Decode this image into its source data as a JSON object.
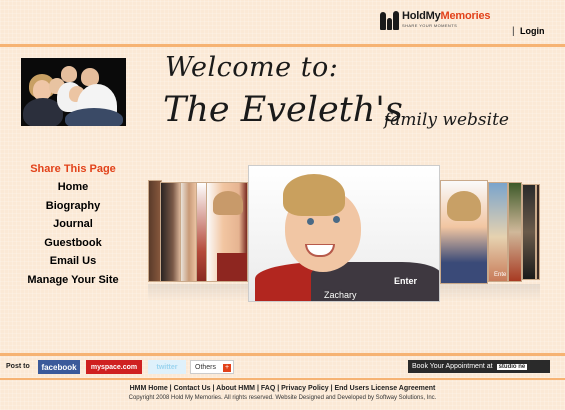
{
  "header": {
    "brand_part1": "Hold",
    "brand_part2": "My",
    "brand_part3": "Memories",
    "tagline": "SHARE YOUR MOMENTS",
    "separator": "|",
    "login_label": "Login"
  },
  "welcome": {
    "line1": "Welcome to:",
    "site_name": "The Eveleth's",
    "subtitle": "family website"
  },
  "nav": {
    "items": [
      {
        "label": "Share This Page"
      },
      {
        "label": "Home"
      },
      {
        "label": "Biography"
      },
      {
        "label": "Journal"
      },
      {
        "label": "Guestbook"
      },
      {
        "label": "Email Us"
      },
      {
        "label": "Manage Your Site"
      }
    ]
  },
  "gallery": {
    "caption": "Zachary",
    "enter_label": "Enter",
    "small_label": "Ente"
  },
  "footer": {
    "post_to": "Post to",
    "facebook": "facebook",
    "myspace": "myspace.com",
    "twitter": "twitter",
    "others": "Others",
    "others_plus": "+",
    "book_text": "Book Your Appointment at",
    "book_logo": "studio ne",
    "links": [
      {
        "label": "HMM Home"
      },
      {
        "label": "Contact Us"
      },
      {
        "label": "About HMM"
      },
      {
        "label": "FAQ"
      },
      {
        "label": "Privacy Policy"
      },
      {
        "label": "End Users License Agreement"
      }
    ],
    "link_separator": " | ",
    "copyright": "Copyright 2008 Hold My Memories. All rights reserved. Website Designed and Developed by Softway Solutions, Inc."
  },
  "colors": {
    "accent": "#e2421a",
    "background": "#fbe9d6",
    "rule": "#f6b373"
  }
}
